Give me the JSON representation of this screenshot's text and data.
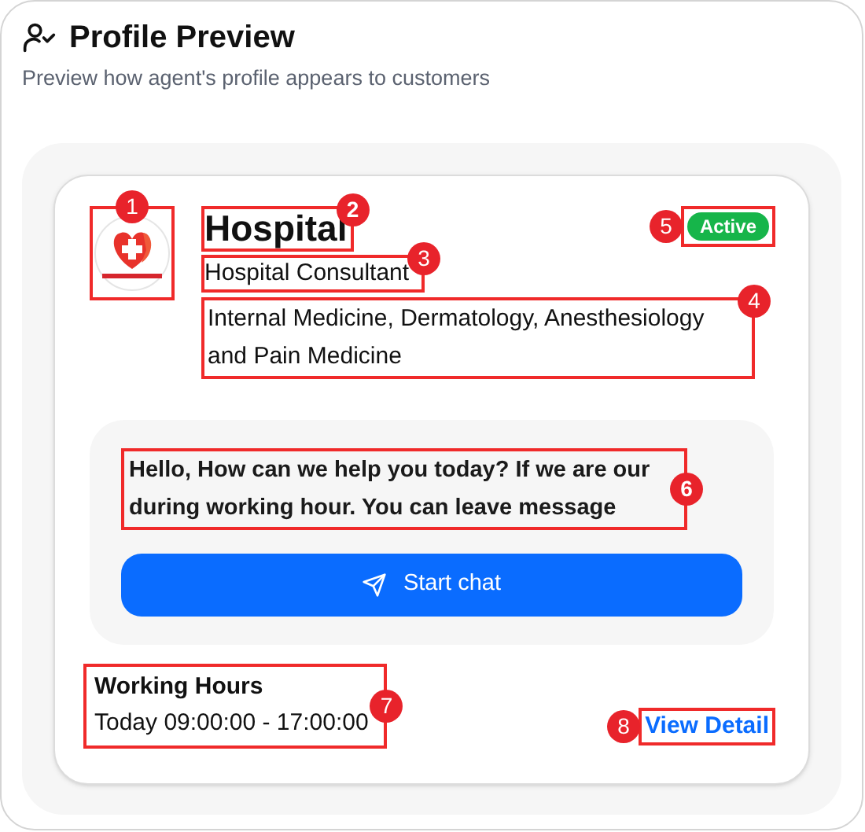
{
  "header": {
    "title": "Profile Preview",
    "subtitle": "Preview how agent's profile appears to customers"
  },
  "profile": {
    "logo": {
      "kind": "picture",
      "annotation": "1"
    },
    "name": {
      "text": "Hospital",
      "annotation": "2"
    },
    "role": {
      "text": "Hospital Consultant",
      "annotation": "3"
    },
    "specialties": {
      "text": "Internal Medicine, Dermatology, Anesthesiology and Pain Medicine",
      "annotation": "4"
    },
    "status": {
      "text": "Active",
      "annotation": "5"
    },
    "greeting": {
      "text": "Hello, How can we help you today? If we are our during working hour. You can leave message",
      "annotation": "6"
    },
    "start_chat_button": "Start chat",
    "working_hours": {
      "title": "Working Hours",
      "value": "Today 09:00:00 - 17:00:00",
      "annotation": "7"
    },
    "view_detail_link": {
      "text": "View Detail",
      "annotation": "8"
    }
  }
}
